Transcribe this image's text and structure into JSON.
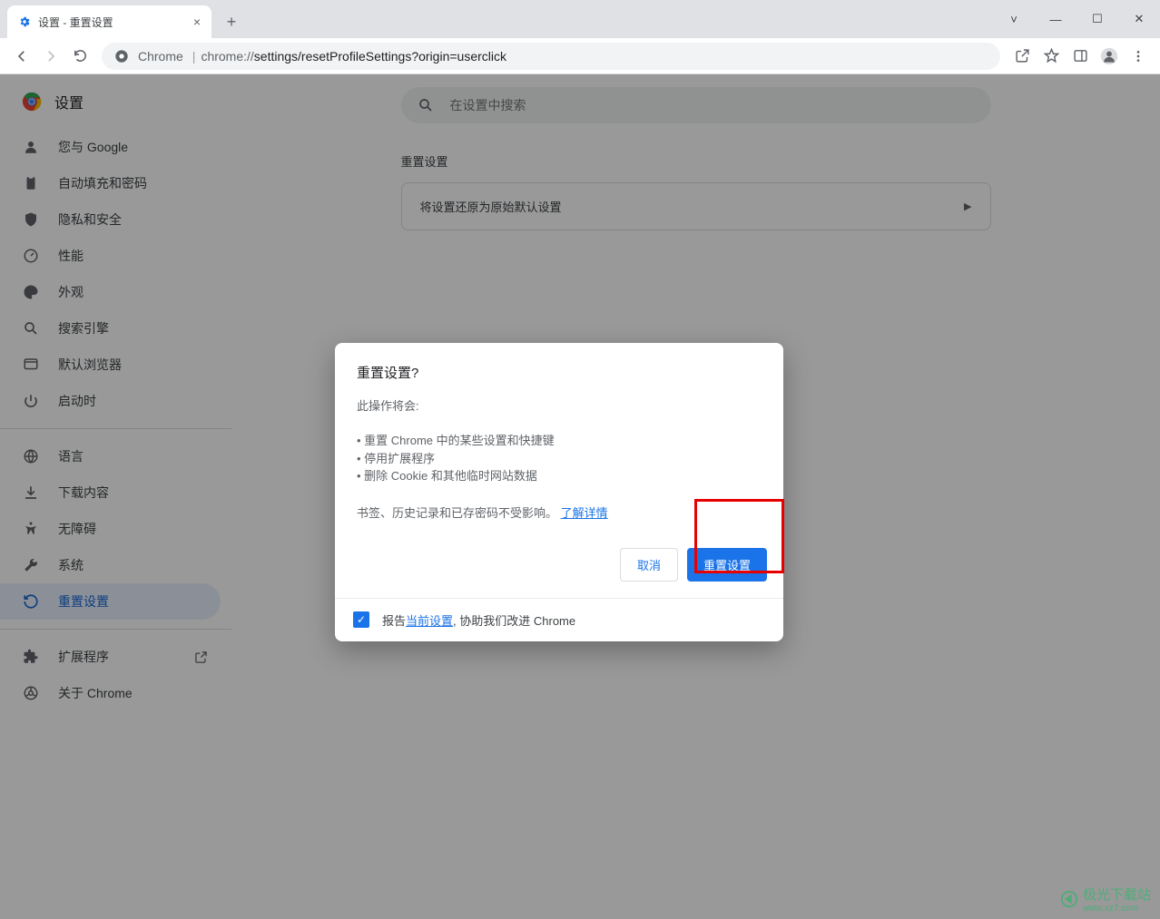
{
  "tab": {
    "title": "设置 - 重置设置"
  },
  "omnibox": {
    "secure_label": "Chrome",
    "url_prefix": "chrome://",
    "url_rest": "settings/resetProfileSettings?origin=userclick"
  },
  "sidebar": {
    "header": "设置",
    "items": [
      {
        "label": "您与 Google"
      },
      {
        "label": "自动填充和密码"
      },
      {
        "label": "隐私和安全"
      },
      {
        "label": "性能"
      },
      {
        "label": "外观"
      },
      {
        "label": "搜索引擎"
      },
      {
        "label": "默认浏览器"
      },
      {
        "label": "启动时"
      },
      {
        "label": "语言"
      },
      {
        "label": "下载内容"
      },
      {
        "label": "无障碍"
      },
      {
        "label": "系统"
      },
      {
        "label": "重置设置"
      },
      {
        "label": "扩展程序"
      },
      {
        "label": "关于 Chrome"
      }
    ]
  },
  "search": {
    "placeholder": "在设置中搜索"
  },
  "section": {
    "title": "重置设置",
    "card": "将设置还原为原始默认设置"
  },
  "dialog": {
    "title": "重置设置?",
    "subtitle": "此操作将会:",
    "bullets": [
      "重置 Chrome 中的某些设置和快捷键",
      "停用扩展程序",
      "删除 Cookie 和其他临时网站数据"
    ],
    "note_prefix": "书签、历史记录和已存密码不受影响。",
    "note_link": "了解详情",
    "cancel": "取消",
    "confirm": "重置设置",
    "footer_prefix": "报告",
    "footer_link": "当前设置",
    "footer_suffix": ", 协助我们改进 Chrome"
  },
  "watermark": {
    "text": "极光下载站",
    "url": "www.xz7.com"
  }
}
